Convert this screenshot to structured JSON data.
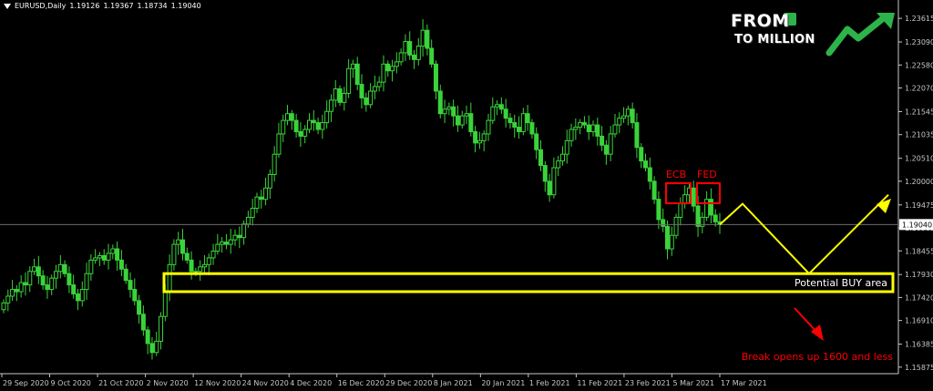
{
  "header": {
    "symbol": "EURUSD,Daily",
    "open": "1.19126",
    "high": "1.19367",
    "low": "1.18734",
    "close": "1.19040"
  },
  "logo": {
    "line1": "FROM",
    "line2": "TO MILLION"
  },
  "colors": {
    "background": "#000000",
    "candle": "#3ad33a",
    "axis": "#c8c8c8",
    "annotation_yellow": "#ffff00",
    "annotation_red": "#ff0000",
    "logo_green": "#2db34a"
  },
  "chart_data": {
    "type": "candlestick",
    "ylim": [
      1.1573,
      1.2386
    ],
    "y_ticks": [
      "1.23615",
      "1.23090",
      "1.22580",
      "1.22070",
      "1.21545",
      "1.21035",
      "1.20510",
      "1.20000",
      "1.19475",
      "1.18965",
      "1.18455",
      "1.17930",
      "1.17420",
      "1.16910",
      "1.16385",
      "1.15875"
    ],
    "x_ticks": [
      "29 Sep 2020",
      "9 Oct 2020",
      "21 Oct 2020",
      "2 Nov 2020",
      "12 Nov 2020",
      "24 Nov 2020",
      "4 Dec 2020",
      "16 Dec 2020",
      "29 Dec 2020",
      "8 Jan 2021",
      "20 Jan 2021",
      "1 Feb 2021",
      "11 Feb 2021",
      "23 Feb 2021",
      "5 Mar 2021",
      "17 Mar 2021"
    ],
    "current_price": "1.19040",
    "grid": false,
    "close_series": [
      1.173,
      1.1745,
      1.176,
      1.1755,
      1.1775,
      1.177,
      1.18,
      1.181,
      1.179,
      1.177,
      1.176,
      1.1785,
      1.18,
      1.1815,
      1.1795,
      1.177,
      1.175,
      1.1735,
      1.176,
      1.1795,
      1.1825,
      1.183,
      1.1835,
      1.1825,
      1.184,
      1.185,
      1.1825,
      1.1805,
      1.178,
      1.176,
      1.1735,
      1.1705,
      1.167,
      1.164,
      1.162,
      1.1645,
      1.17,
      1.1755,
      1.1815,
      1.186,
      1.187,
      1.184,
      1.1825,
      1.18,
      1.18,
      1.181,
      1.1815,
      1.183,
      1.1845,
      1.186,
      1.1865,
      1.186,
      1.187,
      1.188,
      1.1875,
      1.1905,
      1.192,
      1.194,
      1.1965,
      1.196,
      1.1985,
      1.2015,
      1.206,
      1.2105,
      1.2135,
      1.215,
      1.2135,
      1.211,
      1.21,
      1.2115,
      1.2135,
      1.213,
      1.2115,
      1.213,
      1.2155,
      1.218,
      1.2205,
      1.2175,
      1.2195,
      1.225,
      1.226,
      1.2215,
      1.2185,
      1.217,
      1.22,
      1.221,
      1.222,
      1.226,
      1.2245,
      1.2255,
      1.2265,
      1.2285,
      1.231,
      1.228,
      1.227,
      1.23,
      1.2335,
      1.2295,
      1.226,
      1.22,
      1.215,
      1.216,
      1.2165,
      1.2145,
      1.2125,
      1.2145,
      1.215,
      1.211,
      1.2085,
      1.209,
      1.2105,
      1.2135,
      1.2165,
      1.217,
      1.216,
      1.214,
      1.213,
      1.212,
      1.211,
      1.215,
      1.213,
      1.2105,
      1.207,
      1.2035,
      1.2,
      1.197,
      1.203,
      1.2045,
      1.206,
      1.209,
      1.2115,
      1.212,
      1.213,
      1.2125,
      1.211,
      1.2125,
      1.21,
      1.208,
      1.206,
      1.2105,
      1.2125,
      1.214,
      1.2145,
      1.216,
      1.213,
      1.2075,
      1.2045,
      1.203,
      1.2,
      1.196,
      1.1915,
      1.19,
      1.185,
      1.188,
      1.192,
      1.195,
      1.197,
      1.1985,
      1.1945,
      1.19,
      1.192,
      1.196,
      1.1925,
      1.191,
      1.1904
    ],
    "annotations": {
      "ecb_label": "ECB",
      "fed_label": "FED",
      "buy_area_label": "Potential BUY area",
      "break_label": "Break opens up 1600 and less",
      "buy_area_range": [
        1.1755,
        1.1795
      ],
      "projection": [
        [
          1.1904,
          1.195
        ],
        [
          1.195,
          1.1795
        ],
        [
          1.1795,
          1.197
        ]
      ]
    }
  }
}
